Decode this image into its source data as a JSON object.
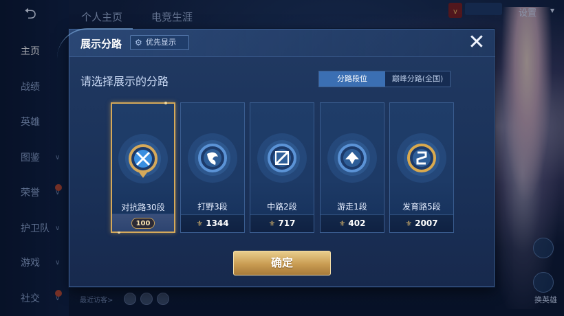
{
  "background": {
    "back_glyph": "⮌",
    "top_tabs": [
      "个人主页",
      "电竞生涯"
    ],
    "settings_label": "设置",
    "sidebar_items": [
      {
        "label": "主页",
        "active": true,
        "chevron": false,
        "badge": false
      },
      {
        "label": "战绩",
        "active": false,
        "chevron": false,
        "badge": false
      },
      {
        "label": "英雄",
        "active": false,
        "chevron": false,
        "badge": false
      },
      {
        "label": "图鉴",
        "active": false,
        "chevron": true,
        "badge": false
      },
      {
        "label": "荣誉",
        "active": false,
        "chevron": true,
        "badge": true
      },
      {
        "label": "护卫队",
        "active": false,
        "chevron": true,
        "badge": false
      },
      {
        "label": "游戏",
        "active": false,
        "chevron": true,
        "badge": false
      },
      {
        "label": "社交",
        "active": false,
        "chevron": true,
        "badge": true
      }
    ],
    "recent_visitors_label": "最近访客>",
    "switch_hero_label": "换英雄"
  },
  "modal": {
    "title": "展示分路",
    "priority_label": "优先显示",
    "prompt": "请选择展示的分路",
    "toggle": {
      "active": "分路段位",
      "inactive": "巅峰分路(全国)"
    },
    "lanes": [
      {
        "label": "对抗路30段",
        "score": "",
        "rank_badge": "100",
        "selected": true,
        "icon": "clash-lane-icon",
        "accent": "#d5a95a"
      },
      {
        "label": "打野3段",
        "score": "1344",
        "rank_badge": "",
        "selected": false,
        "icon": "jungle-icon",
        "accent": "#5b93d6"
      },
      {
        "label": "中路2段",
        "score": "717",
        "rank_badge": "",
        "selected": false,
        "icon": "mid-lane-icon",
        "accent": "#5b93d6"
      },
      {
        "label": "游走1段",
        "score": "402",
        "rank_badge": "",
        "selected": false,
        "icon": "roam-icon",
        "accent": "#5b93d6"
      },
      {
        "label": "发育路5段",
        "score": "2007",
        "rank_badge": "",
        "selected": false,
        "icon": "farm-lane-icon",
        "accent": "#d9a94e"
      }
    ],
    "confirm_label": "确定",
    "close_glyph": "✕",
    "gear_glyph": "⚙",
    "score_glyph": "⚜"
  }
}
